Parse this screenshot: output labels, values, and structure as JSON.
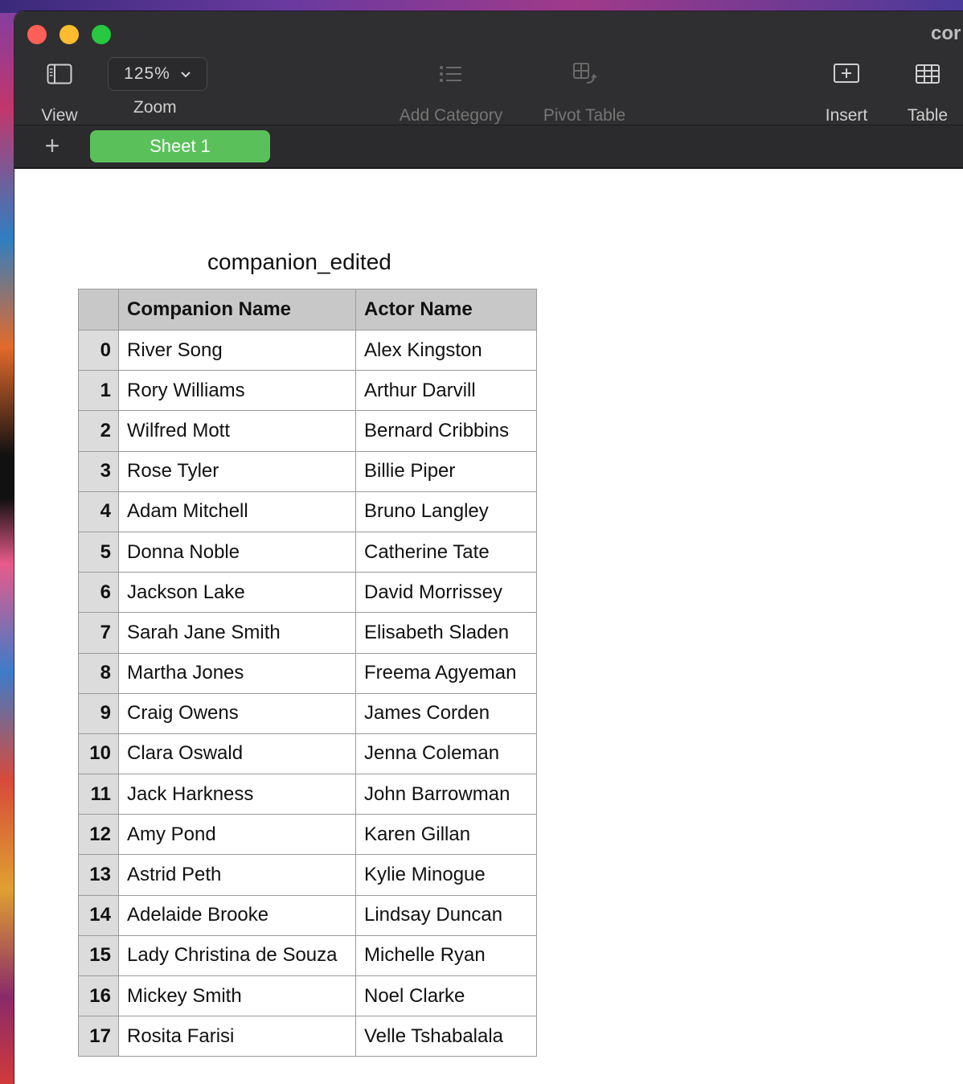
{
  "window": {
    "title": "cor"
  },
  "toolbar": {
    "view": {
      "label": "View",
      "icon": "sidebar-icon"
    },
    "zoom": {
      "label": "Zoom",
      "value": "125%"
    },
    "add_category": {
      "label": "Add Category",
      "icon": "list-icon"
    },
    "pivot_table": {
      "label": "Pivot Table",
      "icon": "pivot-table-icon"
    },
    "insert": {
      "label": "Insert",
      "icon": "insert-icon"
    },
    "table": {
      "label": "Table",
      "icon": "table-icon"
    }
  },
  "sheets": {
    "add_label": "+",
    "active": "Sheet 1"
  },
  "table": {
    "title": "companion_edited",
    "columns": [
      "",
      "Companion Name",
      "Actor Name"
    ],
    "rows": [
      [
        "0",
        "River Song",
        "Alex Kingston"
      ],
      [
        "1",
        "Rory Williams",
        "Arthur Darvill"
      ],
      [
        "2",
        "Wilfred Mott",
        "Bernard Cribbins"
      ],
      [
        "3",
        "Rose Tyler",
        "Billie Piper"
      ],
      [
        "4",
        "Adam Mitchell",
        "Bruno Langley"
      ],
      [
        "5",
        "Donna Noble",
        "Catherine Tate"
      ],
      [
        "6",
        "Jackson Lake",
        "David Morrissey"
      ],
      [
        "7",
        "Sarah Jane Smith",
        "Elisabeth Sladen"
      ],
      [
        "8",
        "Martha Jones",
        "Freema Agyeman"
      ],
      [
        "9",
        "Craig Owens",
        "James Corden"
      ],
      [
        "10",
        "Clara Oswald",
        "Jenna Coleman"
      ],
      [
        "11",
        "Jack Harkness",
        "John Barrowman"
      ],
      [
        "12",
        "Amy Pond",
        "Karen Gillan"
      ],
      [
        "13",
        "Astrid Peth",
        "Kylie Minogue"
      ],
      [
        "14",
        "Adelaide Brooke",
        "Lindsay Duncan"
      ],
      [
        "15",
        "Lady Christina de Souza",
        "Michelle Ryan"
      ],
      [
        "16",
        "Mickey Smith",
        "Noel Clarke"
      ],
      [
        "17",
        "Rosita Farisi",
        "Velle Tshabalala"
      ]
    ]
  },
  "colors": {
    "sheet_tab": "#5ac15a",
    "toolbar_bg": "#2f2f31",
    "header_bg": "#c8c8c8"
  }
}
